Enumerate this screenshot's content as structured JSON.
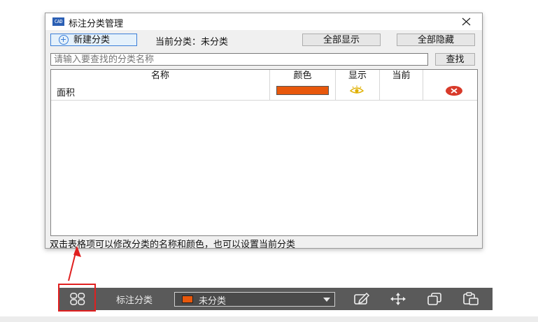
{
  "dialog": {
    "title": "标注分类管理",
    "app_icon_text": "CAD",
    "new_button": "新建分类",
    "current_category": "当前分类：未分类",
    "show_all_button": "全部显示",
    "hide_all_button": "全部隐藏",
    "search_placeholder": "请输入要查找的分类名称",
    "search_button": "查找",
    "table": {
      "columns": [
        "名称",
        "颜色",
        "显示",
        "当前"
      ],
      "rows": [
        {
          "name": "面积",
          "color": "#e8580c",
          "visible": true,
          "current": false
        }
      ]
    },
    "hint": "双击表格项可以修改分类的名称和颜色，也可以设置当前分类"
  },
  "toolbar": {
    "label": "标注分类",
    "selected_category": "未分类",
    "selected_color": "#e8580c",
    "tools": [
      "edit-icon",
      "move-icon",
      "copy-icon",
      "paste-icon"
    ]
  },
  "colors": {
    "annotation_red": "#e02020",
    "accent_blue": "#3c7fd8",
    "toolbar_bg": "#5a5a5a"
  }
}
